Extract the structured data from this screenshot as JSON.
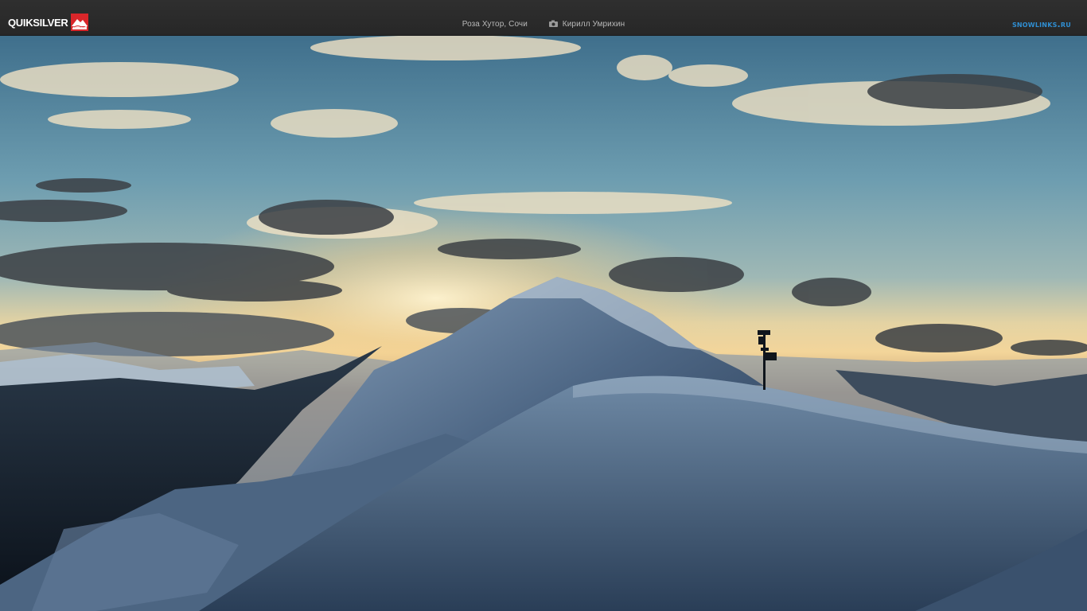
{
  "header": {
    "logo_text": "QUIKSILVER",
    "location": "Роза Хутор, Сочи",
    "photographer": "Кирилл Умрихин",
    "site_brand": "snowlinks.ru"
  },
  "icons": {
    "logo_mark": "quiksilver-wave-mountain-icon",
    "camera": "camera-icon"
  },
  "colors": {
    "header_bg": "#2b2b2b",
    "brand_blue": "#2f8ed2",
    "logo_red": "#d9262a"
  }
}
